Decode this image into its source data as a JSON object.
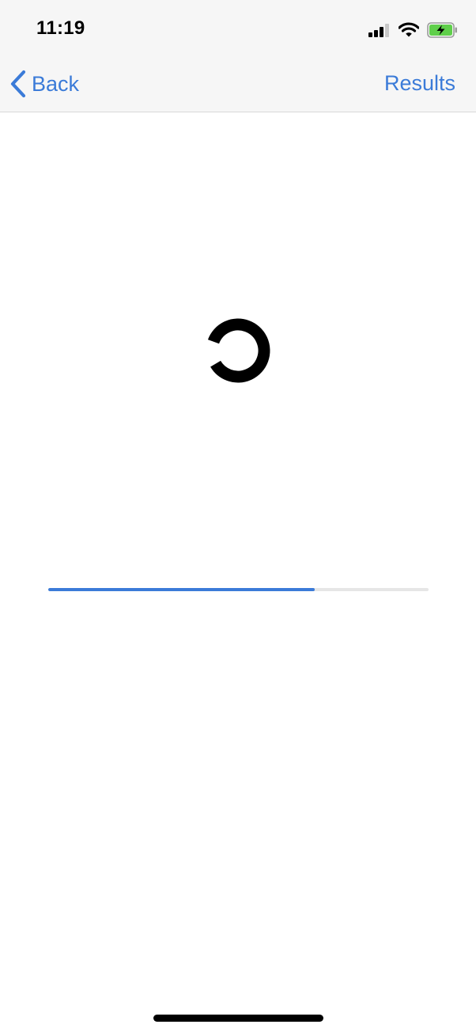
{
  "status_bar": {
    "time": "11:19",
    "icons": [
      "cellular-signal-icon",
      "wifi-icon",
      "battery-charging-icon"
    ]
  },
  "nav": {
    "back_label": "Back",
    "results_label": "Results"
  },
  "loading": {
    "spinner_icon": "loading-spinner-icon",
    "progress": 0.7
  },
  "colors": {
    "accent": "#3b7bd8",
    "navbar_bg": "#f6f6f6",
    "progress_track": "#e6e6e6",
    "battery_fill": "#5fcf4a",
    "text_primary": "#000000"
  }
}
